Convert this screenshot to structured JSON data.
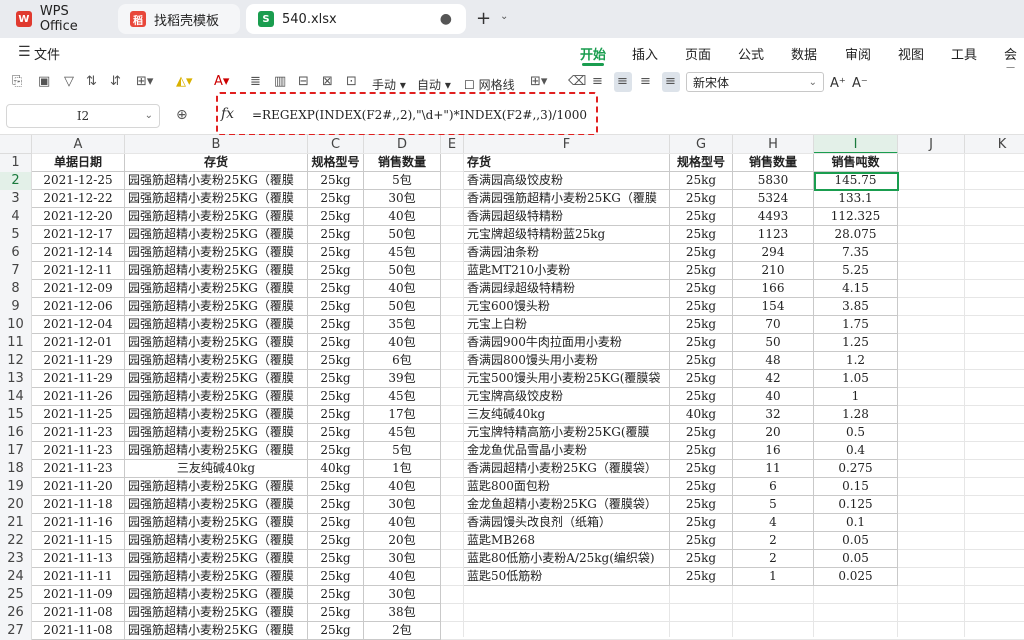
{
  "tabs": {
    "wps": "WPS Office",
    "templates": "找稻壳模板",
    "file": "540.xlsx",
    "file_dot": "●",
    "new_tab": "+",
    "dropdown": "⌄"
  },
  "menu": {
    "file": "文件",
    "tabs": [
      "开始",
      "插入",
      "页面",
      "公式",
      "数据",
      "审阅",
      "视图",
      "工具",
      "会员"
    ]
  },
  "toolbar": {
    "manual": "手动",
    "auto": "自动",
    "gridlines": "网格线",
    "font": "新宋体",
    "grow": "A⁺",
    "shrink": "A⁻"
  },
  "formula_bar": {
    "cell_ref": "I2",
    "fx": "fx",
    "formula": "=REGEXP(INDEX(F2#,,2),\"\\d+\")*INDEX(F2#,,3)/1000"
  },
  "columns": [
    "A",
    "B",
    "C",
    "D",
    "E",
    "F",
    "G",
    "H",
    "I",
    "J",
    "K"
  ],
  "rows": [
    "1",
    "2",
    "3",
    "4",
    "5",
    "6",
    "7",
    "8",
    "9",
    "10",
    "11",
    "12",
    "13",
    "14",
    "15",
    "16",
    "17",
    "18",
    "19",
    "20",
    "21",
    "22",
    "23",
    "24",
    "25",
    "26",
    "27"
  ],
  "left_table": {
    "headers": [
      "单据日期",
      "存货",
      "规格型号",
      "销售数量"
    ],
    "rows": [
      [
        "2021-12-25",
        "园强筋超精小麦粉25KG（覆膜",
        "25kg",
        "5包"
      ],
      [
        "2021-12-22",
        "园强筋超精小麦粉25KG（覆膜",
        "25kg",
        "30包"
      ],
      [
        "2021-12-20",
        "园强筋超精小麦粉25KG（覆膜",
        "25kg",
        "40包"
      ],
      [
        "2021-12-17",
        "园强筋超精小麦粉25KG（覆膜",
        "25kg",
        "50包"
      ],
      [
        "2021-12-14",
        "园强筋超精小麦粉25KG（覆膜",
        "25kg",
        "45包"
      ],
      [
        "2021-12-11",
        "园强筋超精小麦粉25KG（覆膜",
        "25kg",
        "50包"
      ],
      [
        "2021-12-09",
        "园强筋超精小麦粉25KG（覆膜",
        "25kg",
        "40包"
      ],
      [
        "2021-12-06",
        "园强筋超精小麦粉25KG（覆膜",
        "25kg",
        "50包"
      ],
      [
        "2021-12-04",
        "园强筋超精小麦粉25KG（覆膜",
        "25kg",
        "35包"
      ],
      [
        "2021-12-01",
        "园强筋超精小麦粉25KG（覆膜",
        "25kg",
        "40包"
      ],
      [
        "2021-11-29",
        "园强筋超精小麦粉25KG（覆膜",
        "25kg",
        "6包"
      ],
      [
        "2021-11-29",
        "园强筋超精小麦粉25KG（覆膜",
        "25kg",
        "39包"
      ],
      [
        "2021-11-26",
        "园强筋超精小麦粉25KG（覆膜",
        "25kg",
        "45包"
      ],
      [
        "2021-11-25",
        "园强筋超精小麦粉25KG（覆膜",
        "25kg",
        "17包"
      ],
      [
        "2021-11-23",
        "园强筋超精小麦粉25KG（覆膜",
        "25kg",
        "45包"
      ],
      [
        "2021-11-23",
        "园强筋超精小麦粉25KG（覆膜",
        "25kg",
        "5包"
      ],
      [
        "2021-11-23",
        "三友纯碱40kg",
        "40kg",
        "1包"
      ],
      [
        "2021-11-20",
        "园强筋超精小麦粉25KG（覆膜",
        "25kg",
        "40包"
      ],
      [
        "2021-11-18",
        "园强筋超精小麦粉25KG（覆膜",
        "25kg",
        "30包"
      ],
      [
        "2021-11-16",
        "园强筋超精小麦粉25KG（覆膜",
        "25kg",
        "40包"
      ],
      [
        "2021-11-15",
        "园强筋超精小麦粉25KG（覆膜",
        "25kg",
        "20包"
      ],
      [
        "2021-11-13",
        "园强筋超精小麦粉25KG（覆膜",
        "25kg",
        "30包"
      ],
      [
        "2021-11-11",
        "园强筋超精小麦粉25KG（覆膜",
        "25kg",
        "40包"
      ],
      [
        "2021-11-09",
        "园强筋超精小麦粉25KG（覆膜",
        "25kg",
        "30包"
      ],
      [
        "2021-11-08",
        "园强筋超精小麦粉25KG（覆膜",
        "25kg",
        "38包"
      ],
      [
        "2021-11-08",
        "园强筋超精小麦粉25KG（覆膜",
        "25kg",
        "2包"
      ]
    ]
  },
  "right_table": {
    "headers": [
      "存货",
      "规格型号",
      "销售数量",
      "销售吨数"
    ],
    "rows": [
      [
        "香满园高级饺皮粉",
        "25kg",
        "5830",
        "145.75"
      ],
      [
        "香满园强筋超精小麦粉25KG（覆膜",
        "25kg",
        "5324",
        "133.1"
      ],
      [
        "香满园超级特精粉",
        "25kg",
        "4493",
        "112.325"
      ],
      [
        "元宝牌超级特精粉蓝25kg",
        "25kg",
        "1123",
        "28.075"
      ],
      [
        "香满园油条粉",
        "25kg",
        "294",
        "7.35"
      ],
      [
        "蓝匙MT210小麦粉",
        "25kg",
        "210",
        "5.25"
      ],
      [
        "香满园绿超级特精粉",
        "25kg",
        "166",
        "4.15"
      ],
      [
        "元宝600馒头粉",
        "25kg",
        "154",
        "3.85"
      ],
      [
        "元宝上白粉",
        "25kg",
        "70",
        "1.75"
      ],
      [
        "香满园900牛肉拉面用小麦粉",
        "25kg",
        "50",
        "1.25"
      ],
      [
        "香满园800馒头用小麦粉",
        "25kg",
        "48",
        "1.2"
      ],
      [
        "元宝500馒头用小麦粉25KG(覆膜袋",
        "25kg",
        "42",
        "1.05"
      ],
      [
        "元宝牌高级饺皮粉",
        "25kg",
        "40",
        "1"
      ],
      [
        "三友纯碱40kg",
        "40kg",
        "32",
        "1.28"
      ],
      [
        "元宝牌特精高筋小麦粉25KG(覆膜",
        "25kg",
        "20",
        "0.5"
      ],
      [
        "金龙鱼优品雪晶小麦粉",
        "25kg",
        "16",
        "0.4"
      ],
      [
        "香满园超精小麦粉25KG（覆膜袋）",
        "25kg",
        "11",
        "0.275"
      ],
      [
        "蓝匙800面包粉",
        "25kg",
        "6",
        "0.15"
      ],
      [
        "金龙鱼超精小麦粉25KG（覆膜袋）",
        "25kg",
        "5",
        "0.125"
      ],
      [
        "香满园馒头改良剂（纸箱）",
        "25kg",
        "4",
        "0.1"
      ],
      [
        "蓝匙MB268",
        "25kg",
        "2",
        "0.05"
      ],
      [
        "蓝匙80低筋小麦粉A/25kg(编织袋)",
        "25kg",
        "2",
        "0.05"
      ],
      [
        "蓝匙50低筋粉",
        "25kg",
        "1",
        "0.025"
      ]
    ]
  },
  "colors": {
    "accent": "#1a9d4f",
    "highlight": "#e02020"
  }
}
